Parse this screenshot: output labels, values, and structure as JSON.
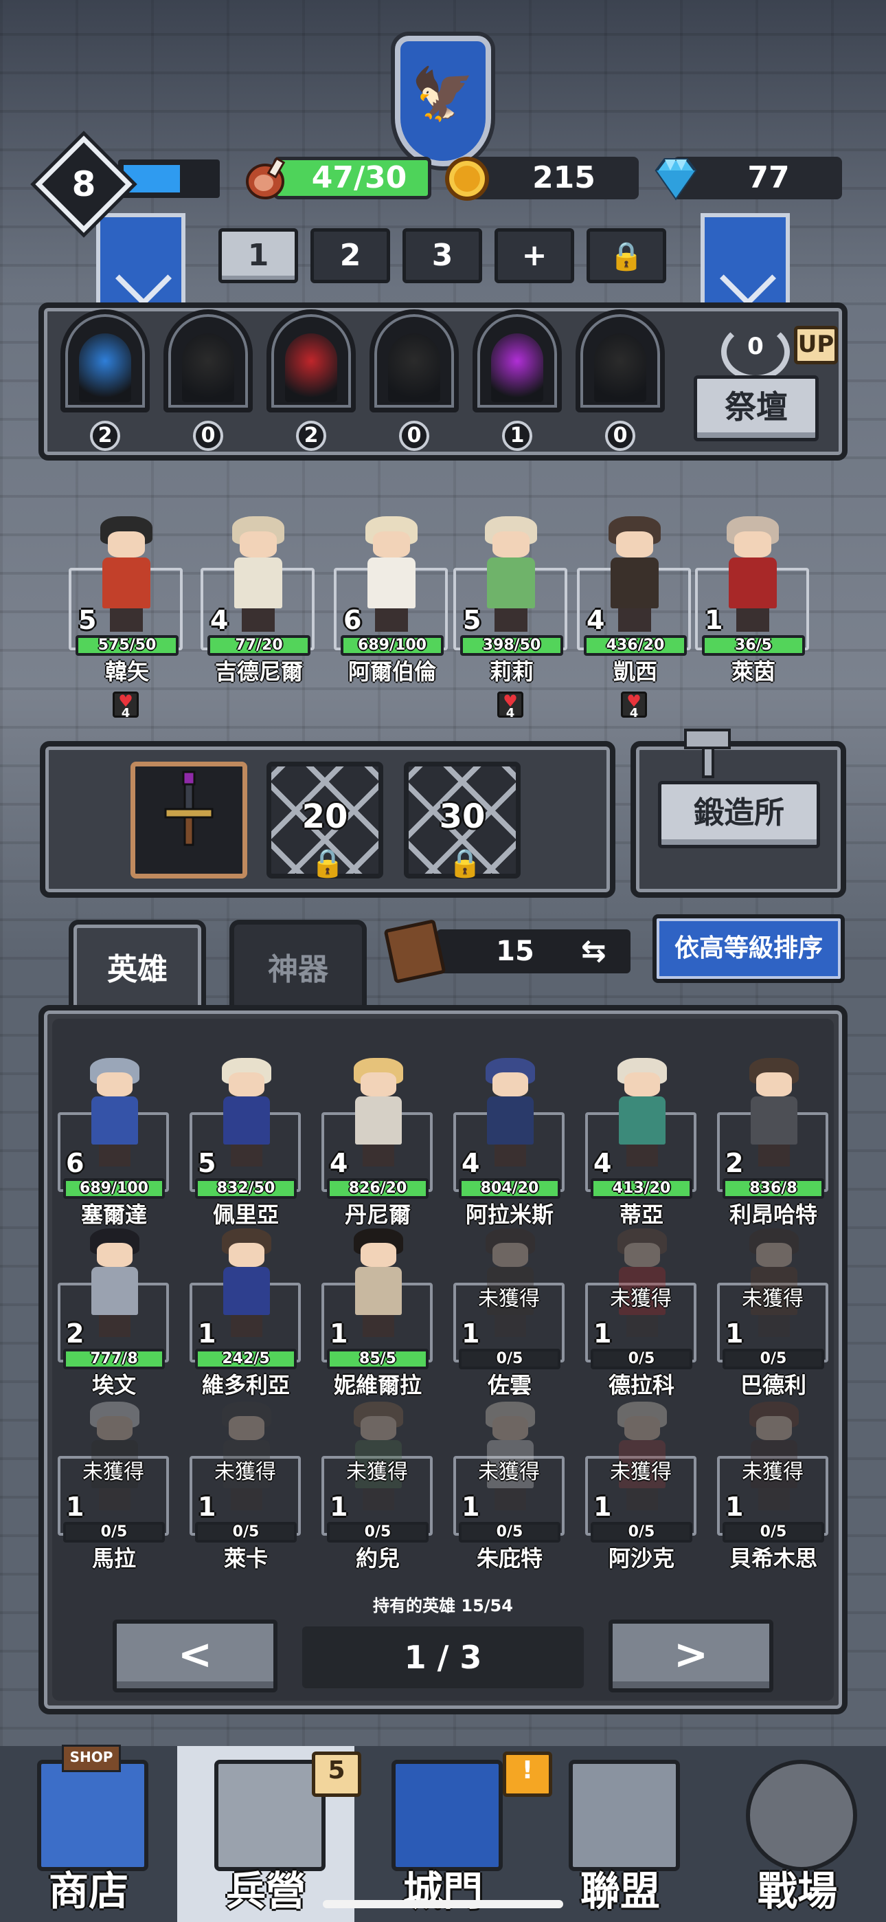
{
  "player": {
    "level": "8",
    "xp_progress": 0.62
  },
  "resources": {
    "food": "47/30",
    "gold": "215",
    "gems": "77",
    "food_icon": "meat-icon",
    "gold_icon": "gold-coin-icon",
    "gem_icon": "diamond-icon"
  },
  "team_tabs": {
    "tab1": "1",
    "tab2": "2",
    "tab3": "3",
    "add": "+",
    "locked_icon": "lock-icon",
    "active": "1"
  },
  "altar": {
    "counts": [
      "2",
      "0",
      "2",
      "0",
      "1",
      "0"
    ],
    "glow_colors": [
      "#2f7fd9",
      "#2b2b2b",
      "#c0262b",
      "#2b2b2b",
      "#b02fd6",
      "#2b2b2b"
    ],
    "level": "0",
    "up_badge": "UP",
    "button_label": "祭壇"
  },
  "active_team": [
    {
      "level": "5",
      "hp": "575/50",
      "name": "韓矢",
      "hearts": "4"
    },
    {
      "level": "4",
      "hp": "77/20",
      "name": "吉德尼爾"
    },
    {
      "level": "6",
      "hp": "689/100",
      "name": "阿爾伯倫"
    },
    {
      "level": "5",
      "hp": "398/50",
      "name": "莉莉",
      "hearts": "4"
    },
    {
      "level": "4",
      "hp": "436/20",
      "name": "凱西",
      "hearts": "4"
    },
    {
      "level": "1",
      "hp": "36/5",
      "name": "萊茵"
    }
  ],
  "equipment": {
    "slot2_unlock": "20",
    "slot3_unlock": "30",
    "forge_label": "鍛造所"
  },
  "hero_tabs": {
    "heroes": "英雄",
    "artifacts": "神器"
  },
  "hero_count": "15",
  "sort_label": "依高等級排序",
  "hero_grid": [
    {
      "level": "6",
      "hp": "689/100",
      "name": "塞爾達",
      "owned": true
    },
    {
      "level": "5",
      "hp": "832/50",
      "name": "佩里亞",
      "owned": true
    },
    {
      "level": "4",
      "hp": "826/20",
      "name": "丹尼爾",
      "owned": true
    },
    {
      "level": "4",
      "hp": "804/20",
      "name": "阿拉米斯",
      "owned": true
    },
    {
      "level": "4",
      "hp": "413/20",
      "name": "蒂亞",
      "owned": true
    },
    {
      "level": "2",
      "hp": "836/8",
      "name": "利昂哈特",
      "owned": true
    },
    {
      "level": "2",
      "hp": "777/8",
      "name": "埃文",
      "owned": true
    },
    {
      "level": "1",
      "hp": "242/5",
      "name": "維多利亞",
      "owned": true
    },
    {
      "level": "1",
      "hp": "85/5",
      "name": "妮維爾拉",
      "owned": true
    },
    {
      "level": "1",
      "hp": "0/5",
      "name": "佐雲",
      "owned": false
    },
    {
      "level": "1",
      "hp": "0/5",
      "name": "德拉科",
      "owned": false
    },
    {
      "level": "1",
      "hp": "0/5",
      "name": "巴德利",
      "owned": false
    },
    {
      "level": "1",
      "hp": "0/5",
      "name": "馬拉",
      "owned": false
    },
    {
      "level": "1",
      "hp": "0/5",
      "name": "萊卡",
      "owned": false
    },
    {
      "level": "1",
      "hp": "0/5",
      "name": "約兒",
      "owned": false
    },
    {
      "level": "1",
      "hp": "0/5",
      "name": "朱庇特",
      "owned": false
    },
    {
      "level": "1",
      "hp": "0/5",
      "name": "阿沙克",
      "owned": false
    },
    {
      "level": "1",
      "hp": "0/5",
      "name": "貝希木思",
      "owned": false
    }
  ],
  "unowned_label": "未獲得",
  "owned_summary": "持有的英雄 15/54",
  "pagination": {
    "prev": "<",
    "page": "1 / 3",
    "next": ">"
  },
  "nav": {
    "shop": "商店",
    "shop_sign": "SHOP",
    "barracks": "兵營",
    "barracks_badge": "5",
    "gate": "城門",
    "gate_badge": "!",
    "alliance": "聯盟",
    "arena": "戰場"
  }
}
